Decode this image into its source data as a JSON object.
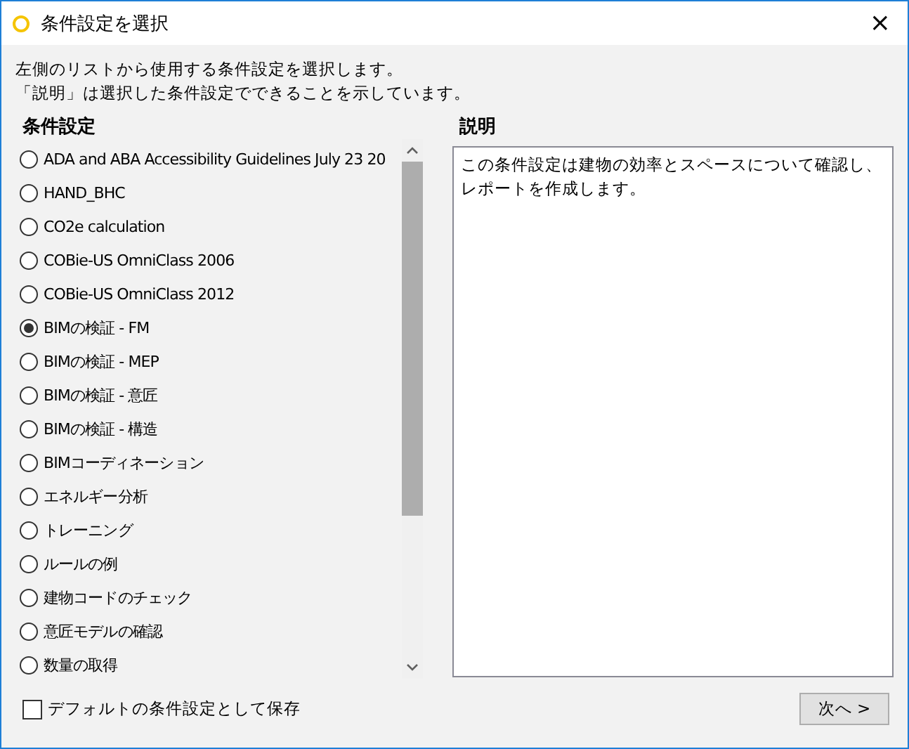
{
  "window": {
    "title": "条件設定を選択",
    "close": "×"
  },
  "instructions": [
    "左側のリストから使用する条件設定を選択します。",
    "「説明」は選択した条件設定でできることを示しています。"
  ],
  "list": {
    "heading": "条件設定",
    "items": [
      {
        "label": "ADA and ABA Accessibility Guidelines July 23 20",
        "selected": false
      },
      {
        "label": "HAND_BHC",
        "selected": false
      },
      {
        "label": "CO2e calculation",
        "selected": false
      },
      {
        "label": "COBie-US OmniClass 2006",
        "selected": false
      },
      {
        "label": "COBie-US OmniClass 2012",
        "selected": false
      },
      {
        "label": "BIMの検証 - FM",
        "selected": true
      },
      {
        "label": "BIMの検証 - MEP",
        "selected": false
      },
      {
        "label": "BIMの検証 - 意匠",
        "selected": false
      },
      {
        "label": "BIMの検証 - 構造",
        "selected": false
      },
      {
        "label": "BIMコーディネーション",
        "selected": false
      },
      {
        "label": "エネルギー分析",
        "selected": false
      },
      {
        "label": "トレーニング",
        "selected": false
      },
      {
        "label": "ルールの例",
        "selected": false
      },
      {
        "label": "建物コードのチェック",
        "selected": false
      },
      {
        "label": "意匠モデルの確認",
        "selected": false
      },
      {
        "label": "数量の取得",
        "selected": false
      }
    ]
  },
  "description": {
    "heading": "説明",
    "text": "この条件設定は建物の効率とスペースについて確認し、レポートを作成します。"
  },
  "save_default": {
    "label": "デフォルトの条件設定として保存",
    "checked": false
  },
  "next_button": "次へ >"
}
